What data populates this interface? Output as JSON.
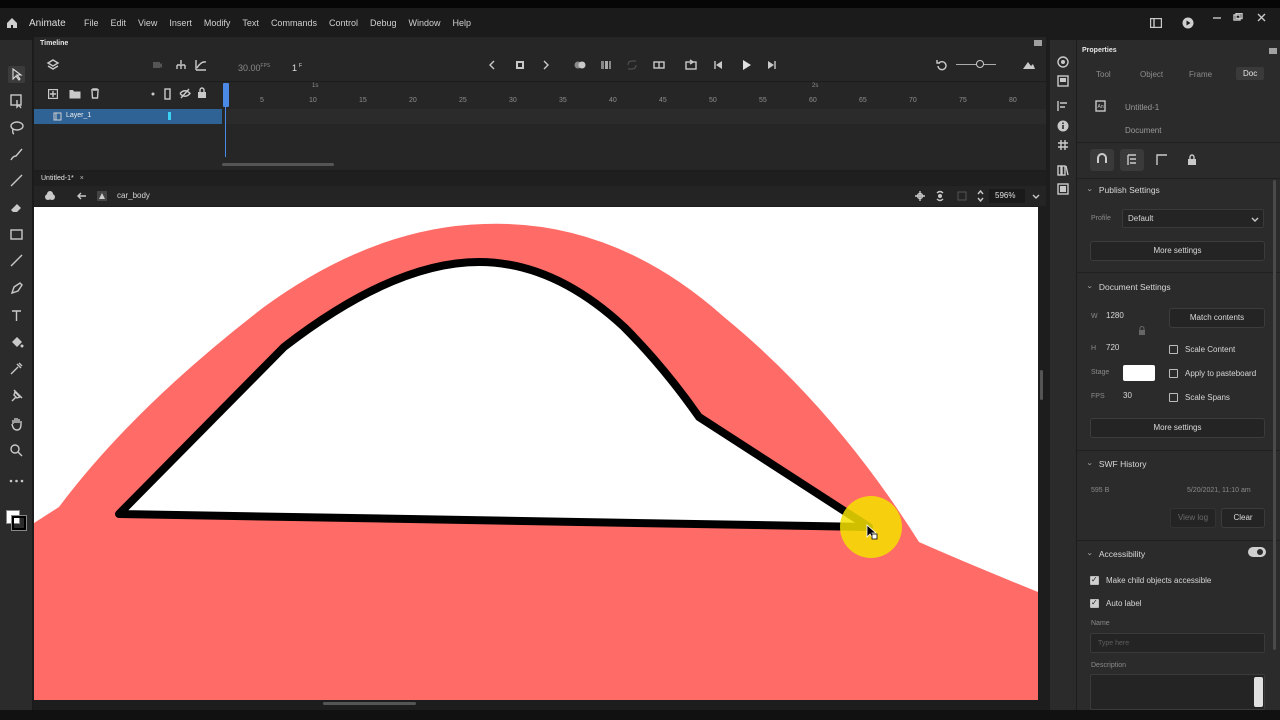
{
  "app": {
    "name": "Animate"
  },
  "menu": [
    "File",
    "Edit",
    "View",
    "Insert",
    "Modify",
    "Text",
    "Commands",
    "Control",
    "Debug",
    "Window",
    "Help"
  ],
  "timeline": {
    "title": "Timeline",
    "fps": "30.00",
    "fps_unit": "FPS",
    "frame": "1",
    "frame_unit": "F",
    "ticks": [
      "5",
      "10",
      "15",
      "20",
      "25",
      "30",
      "35",
      "40",
      "45",
      "50",
      "55",
      "60",
      "65",
      "70",
      "75",
      "80"
    ],
    "seconds_marks": [
      "1s",
      "2s"
    ],
    "layer": {
      "name": "Layer_1"
    }
  },
  "document": {
    "tab": "Untitled-1*",
    "symbol": "car_body",
    "zoom": "596%"
  },
  "properties": {
    "title": "Properties",
    "tabs": [
      "Tool",
      "Object",
      "Frame",
      "Doc"
    ],
    "active_tab": "Doc",
    "doc_name": "Untitled-1",
    "doc_type": "Document",
    "publish": {
      "header": "Publish Settings",
      "profile_label": "Profile",
      "profile_value": "Default",
      "more": "More settings"
    },
    "docsettings": {
      "header": "Document Settings",
      "w_label": "W",
      "w": "1280",
      "h_label": "H",
      "h": "720",
      "stage_label": "Stage",
      "stage_color": "#ffffff",
      "fps_label": "FPS",
      "fps": "30",
      "match": "Match contents",
      "scale_content": "Scale Content",
      "apply_pasteboard": "Apply to pasteboard",
      "scale_spans": "Scale Spans",
      "more": "More settings"
    },
    "swf": {
      "header": "SWF History",
      "size": "595 B",
      "date": "5/20/2021, 11:10 am",
      "view_log": "View log",
      "clear": "Clear"
    },
    "access": {
      "header": "Accessibility",
      "make_child": "Make child objects accessible",
      "auto_label": "Auto label",
      "name_label": "Name",
      "name_placeholder": "Type here",
      "desc_label": "Description"
    }
  },
  "colors": {
    "car_body": "#ff6b66",
    "outline": "#000000",
    "cursor_highlight": "#f5e000",
    "layer_selected": "#2f6295",
    "playhead": "#4a8ae6"
  }
}
